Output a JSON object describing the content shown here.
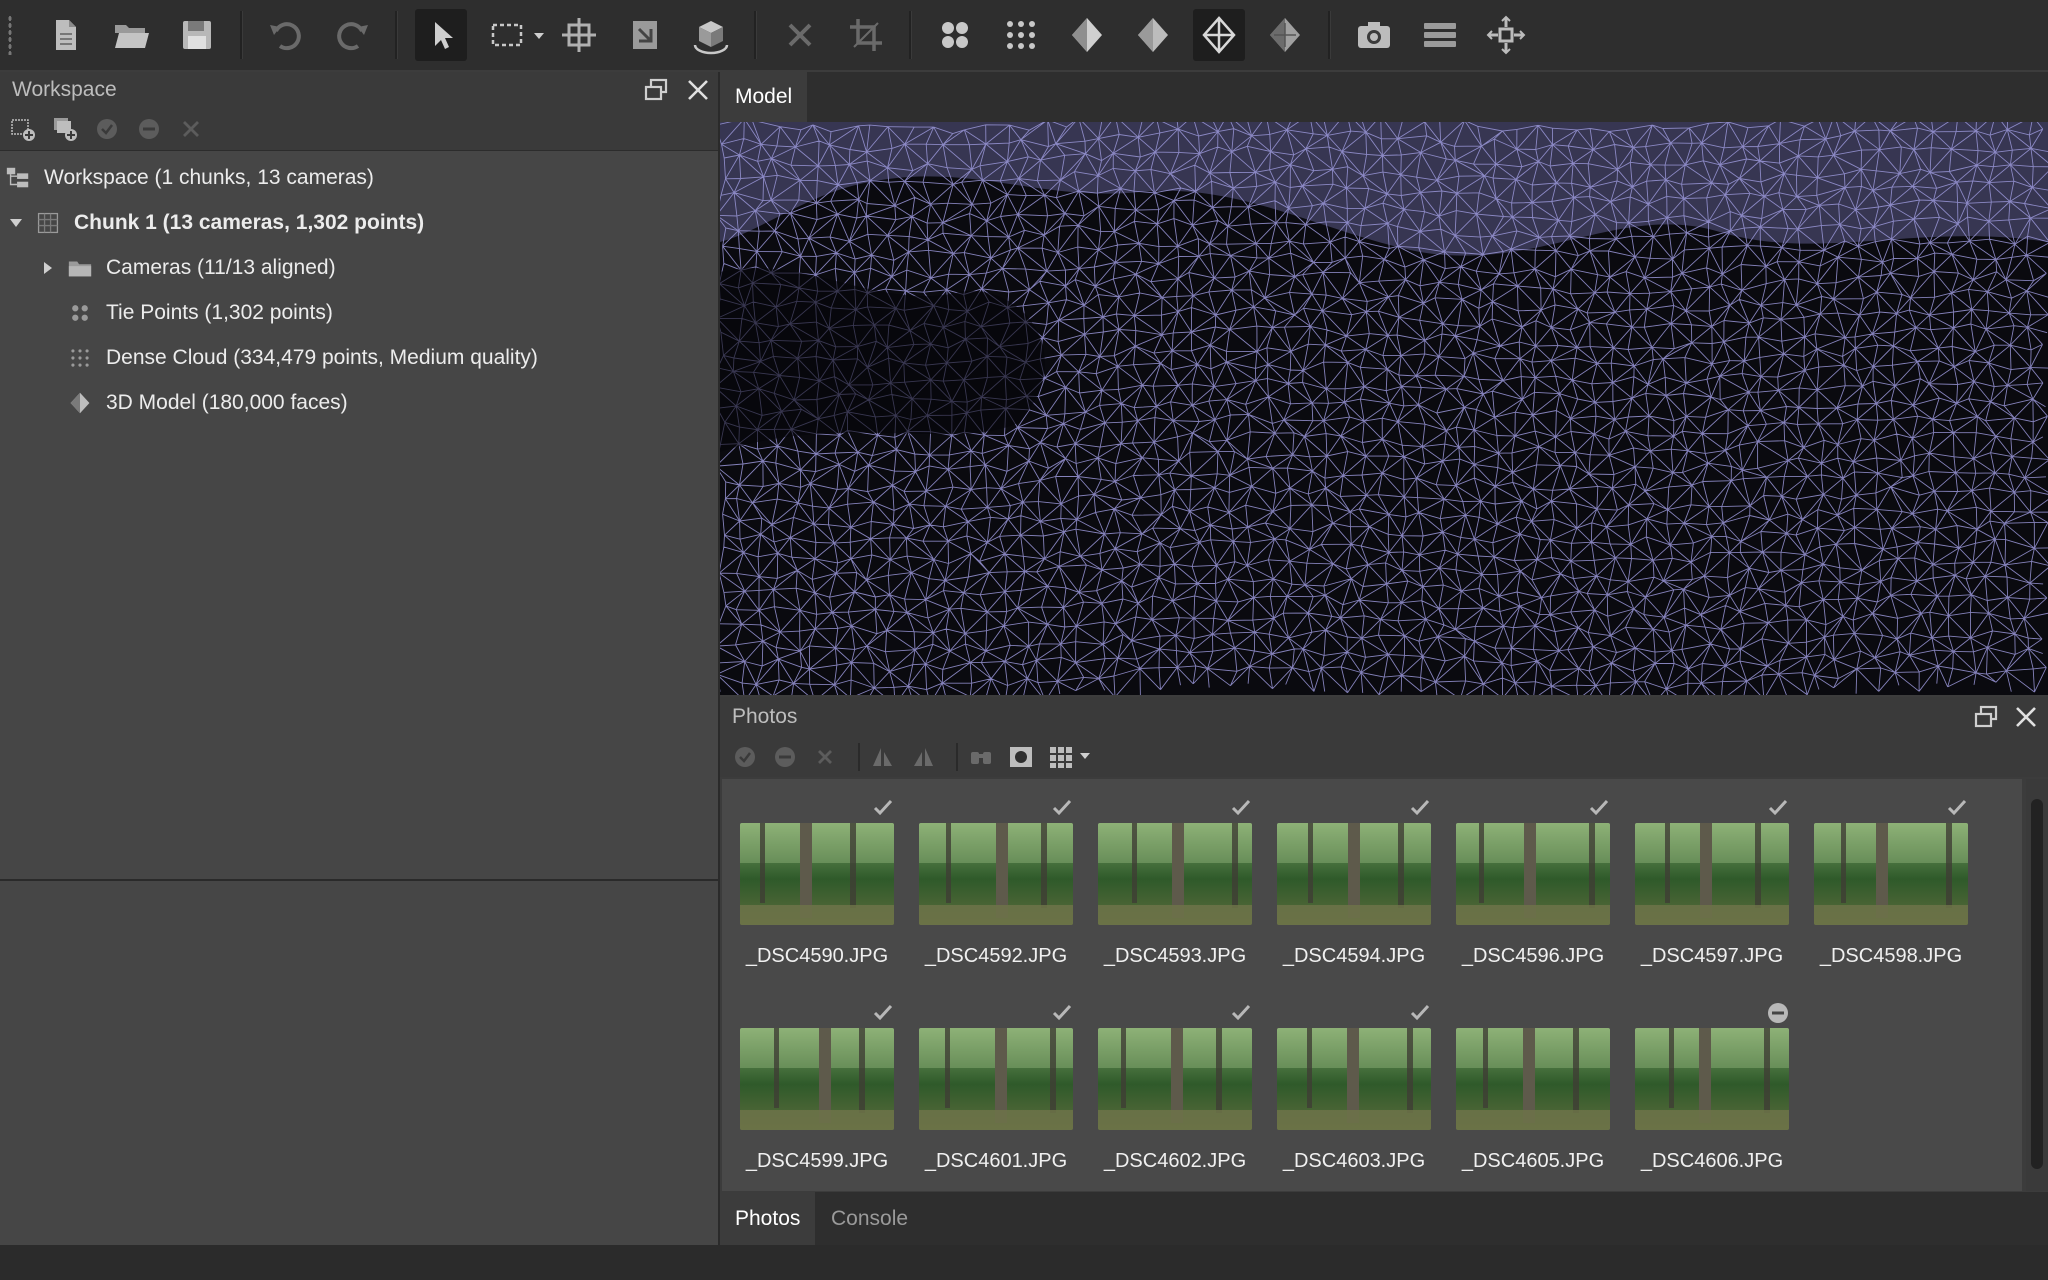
{
  "toolbar": {
    "buttons": [
      "new-icon",
      "open-icon",
      "save-icon",
      "undo-icon",
      "redo-icon",
      "navigation-icon",
      "rectangle-selection-icon",
      "move-region-icon",
      "resize-region-icon",
      "rotate-region-icon",
      "delete-icon",
      "crop-icon",
      "tie-points-icon",
      "dense-cloud-icon",
      "shaded-icon",
      "solid-icon",
      "wireframe-icon",
      "textured-icon",
      "camera-icon",
      "layers-icon",
      "reset-view-icon"
    ]
  },
  "workspace": {
    "title": "Workspace",
    "tree": {
      "root": "Workspace (1 chunks, 13 cameras)",
      "chunk": "Chunk 1 (13 cameras, 1,302 points)",
      "cameras": "Cameras (11/13 aligned)",
      "tie_points": "Tie Points (1,302 points)",
      "dense_cloud": "Dense Cloud (334,479 points, Medium quality)",
      "model": "3D Model (180,000 faces)"
    }
  },
  "model_tab": {
    "label": "Model"
  },
  "photos": {
    "title": "Photos",
    "items": [
      {
        "name": "_DSC4590.JPG",
        "status": "check"
      },
      {
        "name": "_DSC4592.JPG",
        "status": "check"
      },
      {
        "name": "_DSC4593.JPG",
        "status": "check"
      },
      {
        "name": "_DSC4594.JPG",
        "status": "check"
      },
      {
        "name": "_DSC4596.JPG",
        "status": "check"
      },
      {
        "name": "_DSC4597.JPG",
        "status": "check"
      },
      {
        "name": "_DSC4598.JPG",
        "status": "check"
      },
      {
        "name": "_DSC4599.JPG",
        "status": "check"
      },
      {
        "name": "_DSC4601.JPG",
        "status": "check"
      },
      {
        "name": "_DSC4602.JPG",
        "status": "check"
      },
      {
        "name": "_DSC4603.JPG",
        "status": "check"
      },
      {
        "name": "_DSC4605.JPG",
        "status": "none"
      },
      {
        "name": "_DSC4606.JPG",
        "status": "disabled"
      }
    ]
  },
  "bottom_tabs": {
    "photos": "Photos",
    "console": "Console"
  },
  "colors": {
    "mesh": "#9a97d8",
    "background": "#3c3c3c",
    "toolbar": "#2e2e2e"
  }
}
